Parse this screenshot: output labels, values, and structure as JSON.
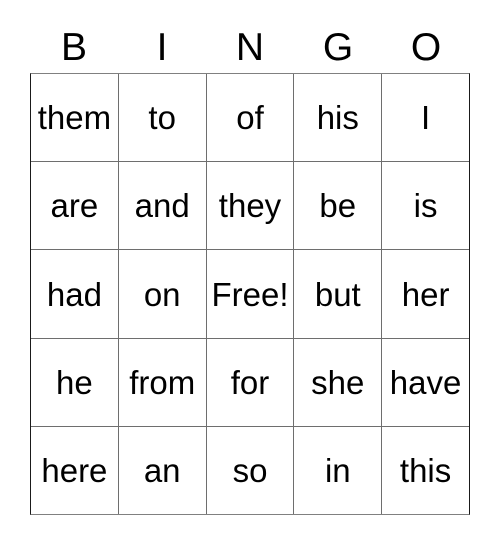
{
  "card": {
    "header_letters": [
      "B",
      "I",
      "N",
      "G",
      "O"
    ],
    "free_space_label": "Free!",
    "colors": {
      "background": "#ffffff",
      "text": "#000000",
      "grid_line": "#6e6e6e",
      "outer_border": "#1a1a1a"
    },
    "rows": [
      {
        "cells": [
          "them",
          "to",
          "of",
          "his",
          "I"
        ]
      },
      {
        "cells": [
          "are",
          "and",
          "they",
          "be",
          "is"
        ]
      },
      {
        "cells": [
          "had",
          "on",
          "Free!",
          "but",
          "her"
        ]
      },
      {
        "cells": [
          "he",
          "from",
          "for",
          "she",
          "have"
        ]
      },
      {
        "cells": [
          "here",
          "an",
          "so",
          "in",
          "this"
        ]
      }
    ]
  }
}
